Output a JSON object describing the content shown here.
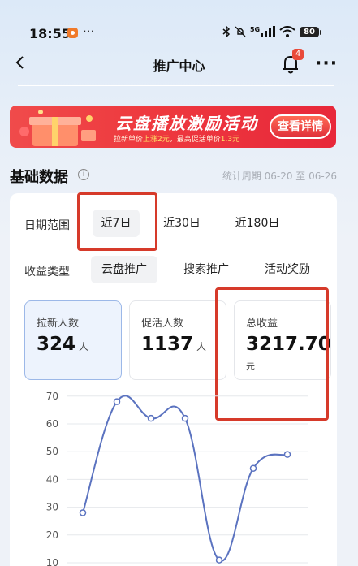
{
  "status_bar": {
    "time": "18:55",
    "more": "···",
    "network": "5G",
    "battery": "80",
    "icons": [
      "bluetooth-icon",
      "mute-icon",
      "signal-icon",
      "wifi-icon",
      "battery-icon"
    ]
  },
  "nav": {
    "title": "推广中心",
    "notification_count": "4",
    "more": "···"
  },
  "banner": {
    "title": "云盘播放激励活动",
    "subtitle_prefix": "拉新单价",
    "subtitle_highlight1": "上涨2元",
    "subtitle_mid": "，最高促活单价",
    "subtitle_highlight2": "1.3元",
    "button": "查看详情"
  },
  "section": {
    "title": "基础数据",
    "info": "i",
    "period": "统计周期 06-20 至 06-26"
  },
  "filters": {
    "date_label": "日期范围",
    "date_options": [
      "近7日",
      "近30日",
      "近180日"
    ],
    "date_selected": "近7日",
    "type_label": "收益类型",
    "type_options": [
      "云盘推广",
      "搜索推广",
      "活动奖励"
    ],
    "type_selected": "云盘推广"
  },
  "kpis": [
    {
      "label": "拉新人数",
      "value": "324",
      "unit": "人"
    },
    {
      "label": "促活人数",
      "value": "1137",
      "unit": "人"
    },
    {
      "label": "总收益",
      "value": "3217.70",
      "unit": "元"
    }
  ],
  "chart_data": {
    "type": "line",
    "x": [
      1,
      2,
      3,
      4,
      5,
      6,
      7
    ],
    "values": [
      28,
      68,
      62,
      62,
      11,
      44,
      49
    ],
    "y_ticks": [
      10,
      20,
      30,
      40,
      50,
      60,
      70
    ],
    "ylim": [
      0,
      72
    ],
    "grid": true,
    "colors": {
      "line": "#5b73c0",
      "grid": "#e6e8ec"
    }
  },
  "colors": {
    "accent": "#9cb8e8",
    "highlight_box": "#d63a2a",
    "banner": "#ee3a3f"
  }
}
